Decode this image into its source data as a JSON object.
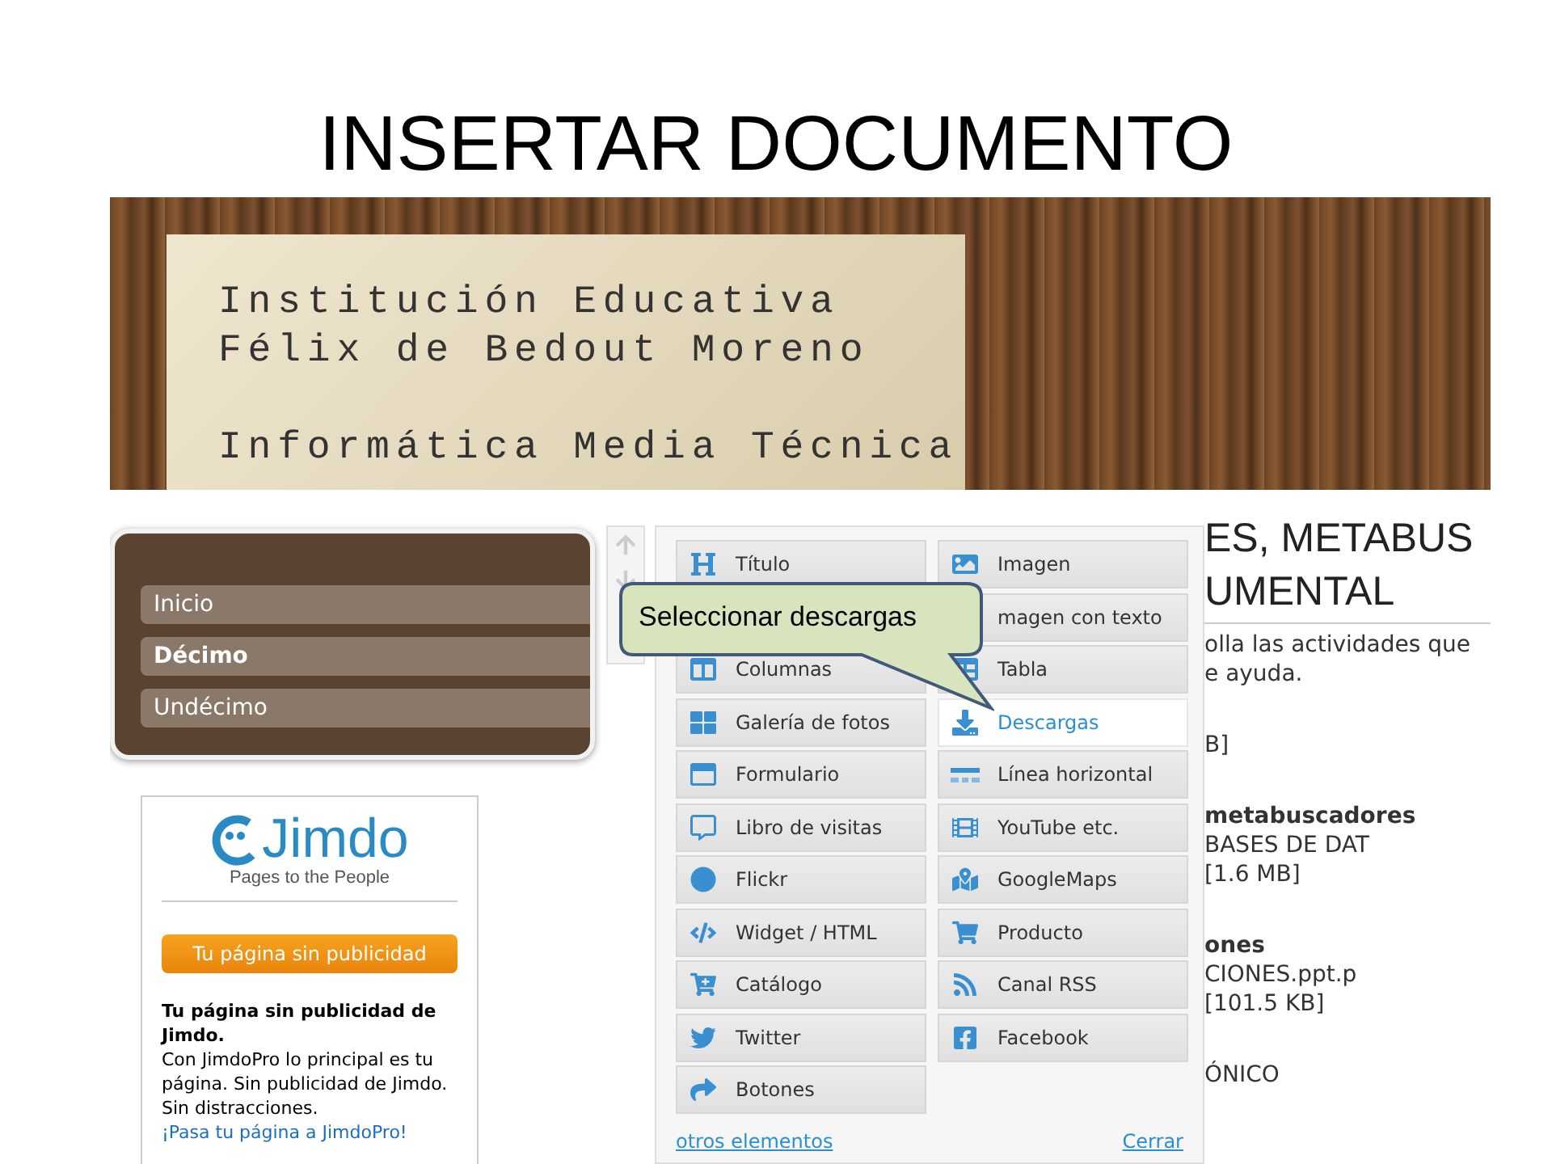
{
  "slide_title": "INSERTAR DOCUMENTO",
  "header": {
    "lines": [
      "Institución Educativa",
      "Félix de Bedout Moreno",
      "Informática Media Técnica"
    ]
  },
  "nav": {
    "items": [
      {
        "label": "Inicio",
        "selected": false
      },
      {
        "label": "Décimo",
        "selected": true
      },
      {
        "label": "Undécimo",
        "selected": false
      }
    ]
  },
  "jimdo": {
    "logo": "Jimdo",
    "tagline": "Pages to the People",
    "button": "Tu página sin publicidad",
    "heading": "Tu página sin publicidad de Jimdo.",
    "body": "Con JimdoPro lo principal es tu página. Sin publicidad de Jimdo. Sin distracciones.",
    "link": "¡Pasa tu página a JimdoPro!"
  },
  "content": [
    {
      "kind": "heading",
      "text": "ES, METABUS"
    },
    {
      "kind": "heading",
      "text": "UMENTAL"
    },
    {
      "kind": "rule"
    },
    {
      "kind": "text",
      "text": "olla las actividades que"
    },
    {
      "kind": "text",
      "text": "e ayuda."
    },
    {
      "kind": "space"
    },
    {
      "kind": "text",
      "text": "B]"
    },
    {
      "kind": "space"
    },
    {
      "kind": "bold",
      "text": "metabuscadores"
    },
    {
      "kind": "text",
      "text": "BASES DE DAT"
    },
    {
      "kind": "text",
      "text": "[1.6 MB]"
    },
    {
      "kind": "space"
    },
    {
      "kind": "bold",
      "text": "ones"
    },
    {
      "kind": "text",
      "text": "CIONES.ppt.p"
    },
    {
      "kind": "text",
      "text": "[101.5 KB]"
    },
    {
      "kind": "space"
    },
    {
      "kind": "text",
      "text": "ÓNICO"
    }
  ],
  "menu": {
    "left": [
      {
        "label": "Título",
        "selected": false
      },
      {
        "label": "Columnas",
        "selected": false
      },
      {
        "label": "Galería de fotos",
        "selected": false
      },
      {
        "label": "Formulario",
        "selected": false
      },
      {
        "label": "Libro de visitas",
        "selected": false
      },
      {
        "label": "Flickr",
        "selected": false
      },
      {
        "label": "Widget / HTML",
        "selected": false
      },
      {
        "label": "Catálogo",
        "selected": false
      },
      {
        "label": "Twitter",
        "selected": false
      },
      {
        "label": "Botones",
        "selected": false
      }
    ],
    "right": [
      {
        "label": "Imagen",
        "selected": false
      },
      {
        "label": "magen con texto",
        "selected": false
      },
      {
        "label": "Tabla",
        "selected": false
      },
      {
        "label": "Descargas",
        "selected": true
      },
      {
        "label": "Línea horizontal",
        "selected": false
      },
      {
        "label": "YouTube etc.",
        "selected": false
      },
      {
        "label": "GoogleMaps",
        "selected": false
      },
      {
        "label": "Producto",
        "selected": false
      },
      {
        "label": "Canal RSS",
        "selected": false
      },
      {
        "label": "Facebook",
        "selected": false
      }
    ],
    "more_link": "otros elementos",
    "close_link": "Cerrar"
  },
  "callout": "Seleccionar descargas"
}
